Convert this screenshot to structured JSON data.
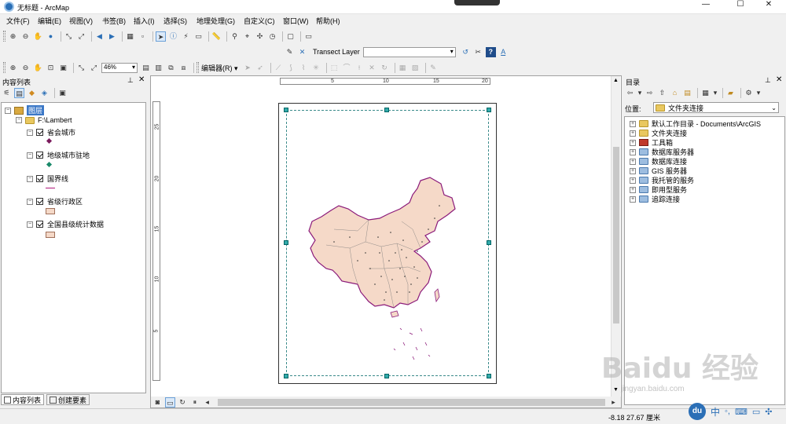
{
  "window": {
    "title": "无标题 - ArcMap",
    "minimize": "—",
    "maximize": "☐",
    "close": "✕"
  },
  "menu": [
    "文件(F)",
    "编辑(E)",
    "视图(V)",
    "书签(B)",
    "插入(I)",
    "选择(S)",
    "地理处理(G)",
    "自定义(C)",
    "窗口(W)",
    "帮助(H)"
  ],
  "toolbar2": {
    "transect_label": "Transect Layer",
    "transect_value": ""
  },
  "toolbar3": {
    "zoom_value": "46%",
    "editor_label": "编辑器(R) ▾"
  },
  "toc": {
    "title": "内容列表",
    "root": "图层",
    "folder": "F:\\Lambert",
    "layers": [
      {
        "name": "省会城市",
        "symbol": "diamond",
        "color": "#7a1a5c"
      },
      {
        "name": "地级城市驻地",
        "symbol": "diamond",
        "color": "#1a8a6a"
      },
      {
        "name": "国界线",
        "symbol": "line",
        "color": "#b0187a"
      },
      {
        "name": "省级行政区",
        "symbol": "fill",
        "color": "#f5d9c8"
      },
      {
        "name": "全国县级统计数据",
        "symbol": "fill",
        "color": "#f5d9c8"
      }
    ],
    "tab_toc": "内容列表",
    "tab_create": "创建要素"
  },
  "ruler": {
    "top": [
      "5",
      "10",
      "15",
      "20"
    ],
    "left": [
      "25",
      "20",
      "15",
      "10",
      "5"
    ]
  },
  "catalog": {
    "title": "目录",
    "location_label": "位置:",
    "location_value": "文件夹连接",
    "items": [
      "默认工作目录 - Documents\\ArcGIS",
      "文件夹连接",
      "工具箱",
      "数据库服务器",
      "数据库连接",
      "GIS 服务器",
      "我托管的服务",
      "即用型服务",
      "追踪连接"
    ]
  },
  "status": {
    "coords": "-8.18  27.67 厘米"
  },
  "watermark": "Baidu 经验",
  "watermark_url": "jingyan.baidu.com",
  "taskbar": {
    "ime": "中",
    "badge": "du"
  },
  "colors": {
    "accent": "#2b6fb6",
    "map_fill": "#f5d9c8",
    "border": "#8b1a7a",
    "handle": "#33aaaa"
  }
}
